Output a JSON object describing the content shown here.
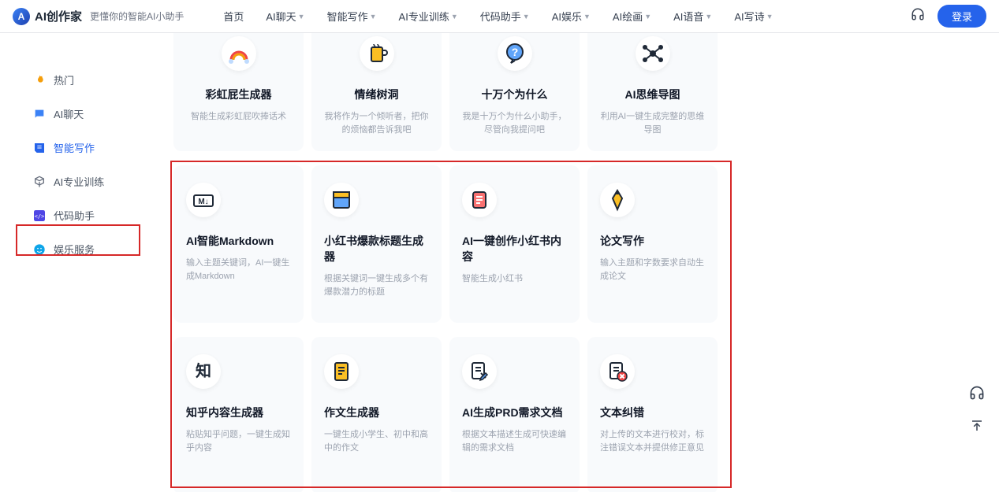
{
  "header": {
    "app_name": "AI创作家",
    "tagline": "更懂你的智能AI小助手",
    "login": "登录"
  },
  "nav": [
    {
      "label": "首页",
      "dropdown": false
    },
    {
      "label": "AI聊天",
      "dropdown": true
    },
    {
      "label": "智能写作",
      "dropdown": true
    },
    {
      "label": "AI专业训练",
      "dropdown": true
    },
    {
      "label": "代码助手",
      "dropdown": true
    },
    {
      "label": "AI娱乐",
      "dropdown": true
    },
    {
      "label": "AI绘画",
      "dropdown": true
    },
    {
      "label": "AI语音",
      "dropdown": true
    },
    {
      "label": "AI写诗",
      "dropdown": true
    }
  ],
  "sidebar": [
    {
      "label": "热门",
      "icon": "fire",
      "color": "#f59e0b"
    },
    {
      "label": "AI聊天",
      "icon": "chat",
      "color": "#3b82f6"
    },
    {
      "label": "智能写作",
      "icon": "edit",
      "color": "#2563eb",
      "active": true
    },
    {
      "label": "AI专业训练",
      "icon": "cube",
      "color": "#6b7280"
    },
    {
      "label": "代码助手",
      "icon": "code",
      "color": "#4f46e5"
    },
    {
      "label": "娱乐服务",
      "icon": "smile",
      "color": "#0ea5e9"
    }
  ],
  "row_top": [
    {
      "title": "彩虹屁生成器",
      "desc": "智能生成彩虹屁吹捧话术",
      "icon": "rainbow"
    },
    {
      "title": "情绪树洞",
      "desc": "我将作为一个倾听者，把你的烦恼都告诉我吧",
      "icon": "cup"
    },
    {
      "title": "十万个为什么",
      "desc": "我是十万个为什么小助手，尽管向我提问吧",
      "icon": "question"
    },
    {
      "title": "AI思维导图",
      "desc": "利用AI一键生成完整的思维导图",
      "icon": "mindmap"
    }
  ],
  "row_mid": [
    {
      "title": "AI智能Markdown",
      "desc": "输入主题关键词，AI一键生成Markdown",
      "icon": "markdown"
    },
    {
      "title": "小红书爆款标题生成器",
      "desc": "根据关键词一键生成多个有爆款潜力的标题",
      "icon": "window"
    },
    {
      "title": "AI一键创作小红书内容",
      "desc": "智能生成小红书",
      "icon": "note"
    },
    {
      "title": "论文写作",
      "desc": "输入主题和字数要求自动生成论文",
      "icon": "pen"
    }
  ],
  "row_bot": [
    {
      "title": "知乎内容生成器",
      "desc": "粘贴知乎问题，一键生成知乎内容",
      "icon": "zhi"
    },
    {
      "title": "作文生成器",
      "desc": "一键生成小学生、初中和高中的作文",
      "icon": "doc"
    },
    {
      "title": "AI生成PRD需求文档",
      "desc": "根据文本描述生成可快速编辑的需求文档",
      "icon": "docedit"
    },
    {
      "title": "文本纠错",
      "desc": "对上传的文本进行校对，标注错误文本并提供修正意见",
      "icon": "docerror"
    }
  ]
}
